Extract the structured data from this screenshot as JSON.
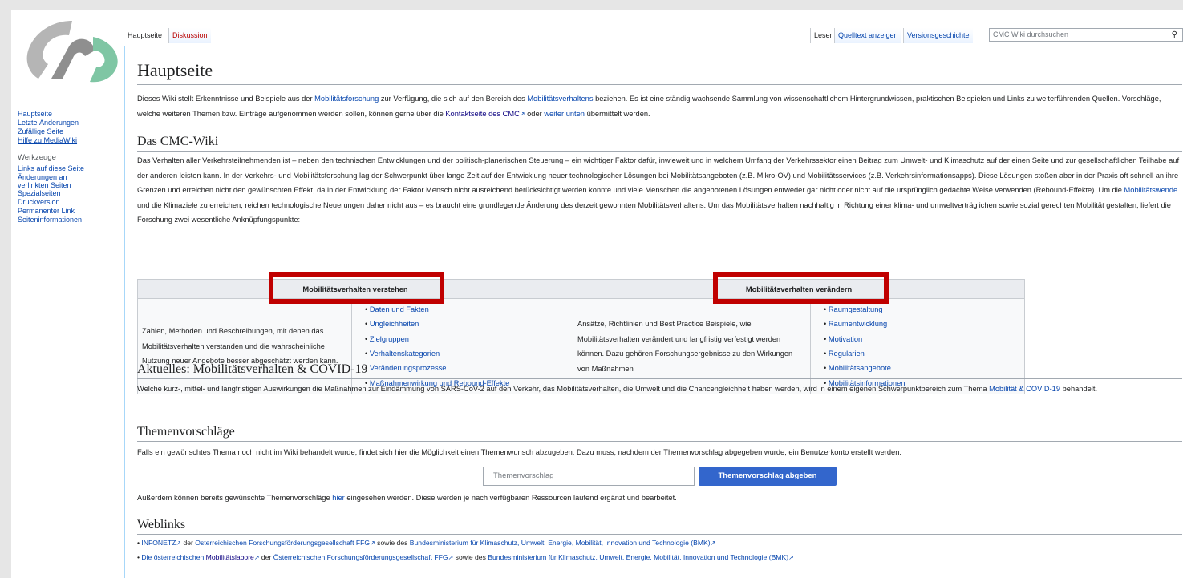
{
  "logo": {
    "name": "cmc-logo",
    "colors": [
      "#b0b0b0",
      "#7fc6a4"
    ]
  },
  "sidebar": {
    "nav": [
      {
        "label": "Hauptseite"
      },
      {
        "label": "Letzte Änderungen"
      },
      {
        "label": "Zufällige Seite"
      },
      {
        "label": "Hilfe zu MediaWiki"
      }
    ],
    "tools_heading": "Werkzeuge",
    "tools": [
      {
        "label": "Links auf diese Seite"
      },
      {
        "label": "Änderungen an verlinkten Seiten"
      },
      {
        "label": "Spezialseiten"
      },
      {
        "label": "Druckversion"
      },
      {
        "label": "Permanenter Link"
      },
      {
        "label": "Seiteninformationen"
      }
    ]
  },
  "tabs": {
    "left": [
      "Hauptseite",
      "Diskussion"
    ],
    "right": [
      "Lesen",
      "Quelltext anzeigen",
      "Versionsgeschichte"
    ]
  },
  "search": {
    "placeholder": "CMC Wiki durchsuchen"
  },
  "page": {
    "title": "Hauptseite",
    "intro": {
      "t1": "Dieses Wiki stellt Erkenntnisse und Beispiele aus der ",
      "l1": "Mobilitätsforschung",
      "t2": " zur Verfügung, die sich auf den Bereich des ",
      "l2": "Mobilitätsverhaltens",
      "t3": " beziehen. Es ist eine ständig wachsende Sammlung von wissenschaftlichem Hintergrundwissen, praktischen Beispielen und Links zu weiterführenden Quellen. Vorschläge, welche weiteren Themen bzw. Einträge aufgenommen werden sollen, können gerne über die ",
      "l3": "Kontaktseite des CMC",
      "t4": " oder ",
      "l4": "weiter unten",
      "t5": " übermittelt werden."
    },
    "sec1": {
      "heading": "Das CMC-Wiki",
      "t1": "Das Verhalten aller Verkehrsteilnehmenden ist – neben den technischen Entwicklungen und der politisch-planerischen Steuerung – ein wichtiger Faktor dafür, inwieweit und in welchem Umfang der Verkehrssektor einen Beitrag zum Umwelt- und Klimaschutz auf der einen Seite und zur gesellschaftlichen Teilhabe auf der anderen leisten kann. In der Verkehrs- und Mobilitätsforschung lag der Schwerpunkt über lange Zeit auf der Entwicklung neuer technologischer Lösungen bei Mobilitätsangeboten (z.B. Mikro-ÖV) und Mobilitätsservices (z.B. Verkehrsinformationsapps). Diese Lösungen stoßen aber in der Praxis oft schnell an ihre Grenzen und erreichen nicht den gewünschten Effekt, da in der Entwicklung der Faktor Mensch nicht ausreichend berücksichtigt werden konnte und viele Menschen die angebotenen Lösungen entweder gar nicht oder nicht auf die ursprünglich gedachte Weise verwenden (Rebound-Effekte). Um die ",
      "l1": "Mobilitätswende",
      "t2": " und die Klimaziele zu erreichen, reichen technologische Neuerungen daher nicht aus – es braucht eine grundlegende Änderung des derzeit gewohnten Mobilitätsverhaltens. Um das Mobilitätsverhalten nachhaltig in Richtung einer klima- und umweltverträglichen sowie sozial gerechten Mobilität gestalten, liefert die Forschung zwei wesentliche Anknüpfungspunkte:"
    },
    "table": {
      "col1_header": "Mobilitätsverhalten verstehen",
      "col1_text": "Zahlen, Methoden und Beschreibungen, mit denen das Mobilitätsverhalten verstanden und die wahrscheinliche Nutzung neuer Angebote besser abgeschätzt werden kann.",
      "col1_links": [
        "Daten und Fakten",
        "Ungleichheiten",
        "Zielgruppen",
        "Verhaltenskategorien",
        "Veränderungsprozesse",
        "Maßnahmenwirkung und Rebound-Effekte"
      ],
      "col2_header": "Mobilitätsverhalten verändern",
      "col2_text": "Ansätze, Richtlinien und Best Practice Beispiele, wie Mobilitätsverhalten verändert und langfristig verfestigt werden können. Dazu gehören Forschungsergebnisse zu den Wirkungen von Maßnahmen",
      "col2_links": [
        "Raumgestaltung",
        "Raumentwicklung",
        "Motivation",
        "Regularien",
        "Mobilitätsangebote",
        "Mobilitätsinformationen"
      ]
    },
    "sec2": {
      "heading": "Aktuelles: Mobilitätsverhalten & COVID-19",
      "t1": "Welche kurz-, mittel- und langfristigen Auswirkungen die Maßnahmen zur Eindämmung von SARS-CoV-2 auf den Verkehr, das Mobilitätsverhalten, die Umwelt und die Chancengleichheit haben werden, wird in einem eigenen Schwerpunktbereich zum Thema ",
      "l1": "Mobilität & COVID-19",
      "t2": " behandelt."
    },
    "sec3": {
      "heading": "Themenvorschläge",
      "t1": "Falls ein gewünschtes Thema noch nicht im Wiki behandelt wurde, findet sich hier die Möglichkeit einen Themenwunsch abzugeben. Dazu muss, nachdem der Themenvorschlag abgegeben wurde, ein Benutzerkonto erstellt werden.",
      "input_placeholder": "Themenvorschlag",
      "button": "Themenvorschlag abgeben",
      "t2": "Außerdem können bereits gewünschte Themenvorschläge ",
      "l1": "hier",
      "t3": " eingesehen werden. Diese werden je nach verfügbaren Ressourcen laufend ergänzt und bearbeitet."
    },
    "sec4": {
      "heading": "Weblinks",
      "w1": {
        "a": "INFONETZ",
        "b": " der ",
        "c": "Österreichischen Forschungsförderungsgesellschaft FFG",
        "d": " sowie des ",
        "e": "Bundesministerium für Klimaschutz, Umwelt, Energie, Mobilität, Innovation und Technologie (BMK)"
      },
      "w2": {
        "a": "Die österreichischen ",
        "a2": "Mobilitätslabore",
        "b": " der ",
        "c": "Österreichischen Forschungsförderungsgesellschaft FFG",
        "d": " sowie des ",
        "e": "Bundesministerium für Klimaschutz, Umwelt, Energie, Mobilität, Innovation und Technologie (BMK)"
      }
    }
  },
  "highlight_color": "#c00000",
  "accent": "#3366cc"
}
